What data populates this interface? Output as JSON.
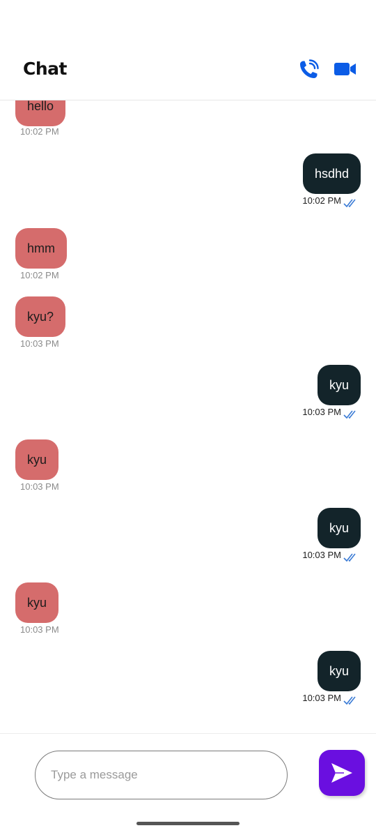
{
  "header": {
    "title": "Chat",
    "call_icon": "phone-call-icon",
    "video_icon": "video-camera-icon",
    "accent_color": "#0b5ce6"
  },
  "messages": [
    {
      "direction": "received",
      "text": "hello",
      "time": "10:02 PM"
    },
    {
      "direction": "sent",
      "text": "hsdhd",
      "time": "10:02 PM",
      "status_icon": "double-check-icon"
    },
    {
      "direction": "received",
      "text": "hmm",
      "time": "10:02 PM"
    },
    {
      "direction": "received",
      "text": "kyu?",
      "time": "10:03 PM"
    },
    {
      "direction": "sent",
      "text": "kyu",
      "time": "10:03 PM",
      "status_icon": "double-check-icon"
    },
    {
      "direction": "received",
      "text": "kyu",
      "time": "10:03 PM"
    },
    {
      "direction": "sent",
      "text": "kyu",
      "time": "10:03 PM",
      "status_icon": "double-check-icon"
    },
    {
      "direction": "received",
      "text": "kyu",
      "time": "10:03 PM"
    },
    {
      "direction": "sent",
      "text": "kyu",
      "time": "10:03 PM",
      "status_icon": "double-check-icon"
    }
  ],
  "colors": {
    "received_bubble": "#d56c6c",
    "sent_bubble": "#13242a",
    "read_ticks": "#3a7bd5",
    "send_button": "#6a0fe0"
  },
  "composer": {
    "placeholder": "Type a message",
    "value": "",
    "send_icon": "send-icon"
  }
}
